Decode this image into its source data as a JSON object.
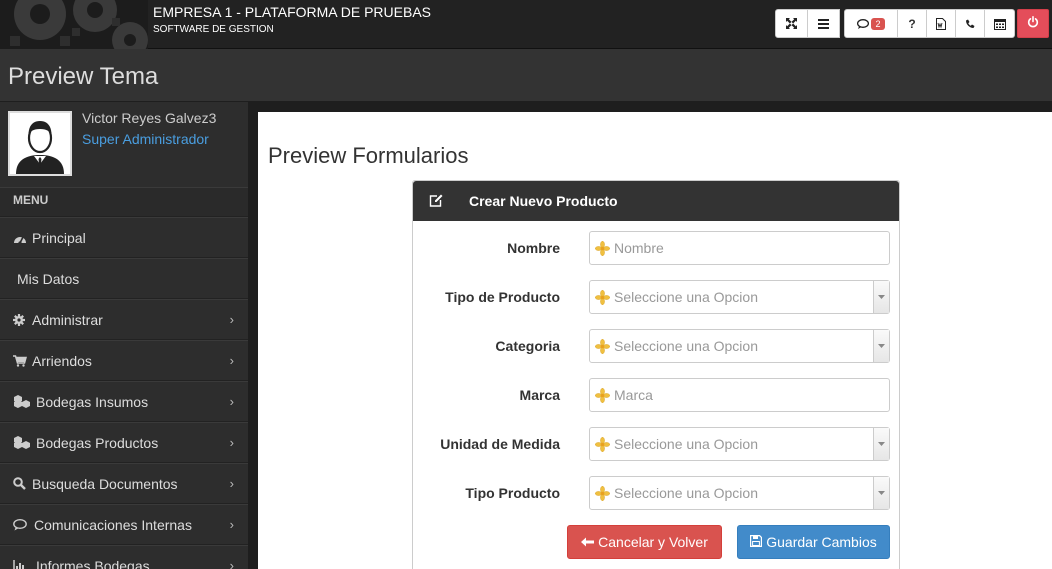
{
  "header": {
    "company": "EMPRESA 1 - PLATAFORMA DE PRUEBAS",
    "subtitle": "SOFTWARE DE GESTION",
    "messages_count": "2",
    "help_label": "?"
  },
  "page": {
    "title": "Preview Tema"
  },
  "user": {
    "name": "Victor Reyes Galvez3",
    "role": "Super Administrador"
  },
  "menu": {
    "heading": "MENU",
    "items": [
      {
        "label": "Principal",
        "icon": "dashboard-icon"
      },
      {
        "label": "Mis Datos",
        "icon": ""
      },
      {
        "label": "Administrar",
        "icon": "gear-icon"
      },
      {
        "label": "Arriendos",
        "icon": "cart-icon"
      },
      {
        "label": "Bodegas Insumos",
        "icon": "cubes-icon"
      },
      {
        "label": "Bodegas Productos",
        "icon": "cubes-icon"
      },
      {
        "label": "Busqueda Documentos",
        "icon": "search-icon"
      },
      {
        "label": "Comunicaciones Internas",
        "icon": "chat-icon"
      },
      {
        "label": "Informes Bodegas",
        "icon": "bar-chart-icon"
      }
    ]
  },
  "main": {
    "title": "Preview Formularios",
    "card_title": "Crear Nuevo Producto",
    "fields": [
      {
        "label": "Nombre",
        "placeholder": "Nombre",
        "type": "input"
      },
      {
        "label": "Tipo de Producto",
        "placeholder": "Seleccione una Opcion",
        "type": "select"
      },
      {
        "label": "Categoria",
        "placeholder": "Seleccione una Opcion",
        "type": "select"
      },
      {
        "label": "Marca",
        "placeholder": "Marca",
        "type": "input"
      },
      {
        "label": "Unidad de Medida",
        "placeholder": "Seleccione una Opcion",
        "type": "select"
      },
      {
        "label": "Tipo Producto",
        "placeholder": "Seleccione una Opcion",
        "type": "select"
      }
    ],
    "cancel_label": "Cancelar y Volver",
    "save_label": "Guardar Cambios"
  },
  "colors": {
    "accent_blue": "#428bca",
    "danger_red": "#d9534f",
    "power_red": "#e44d5a",
    "role_link": "#4a9ee0"
  }
}
